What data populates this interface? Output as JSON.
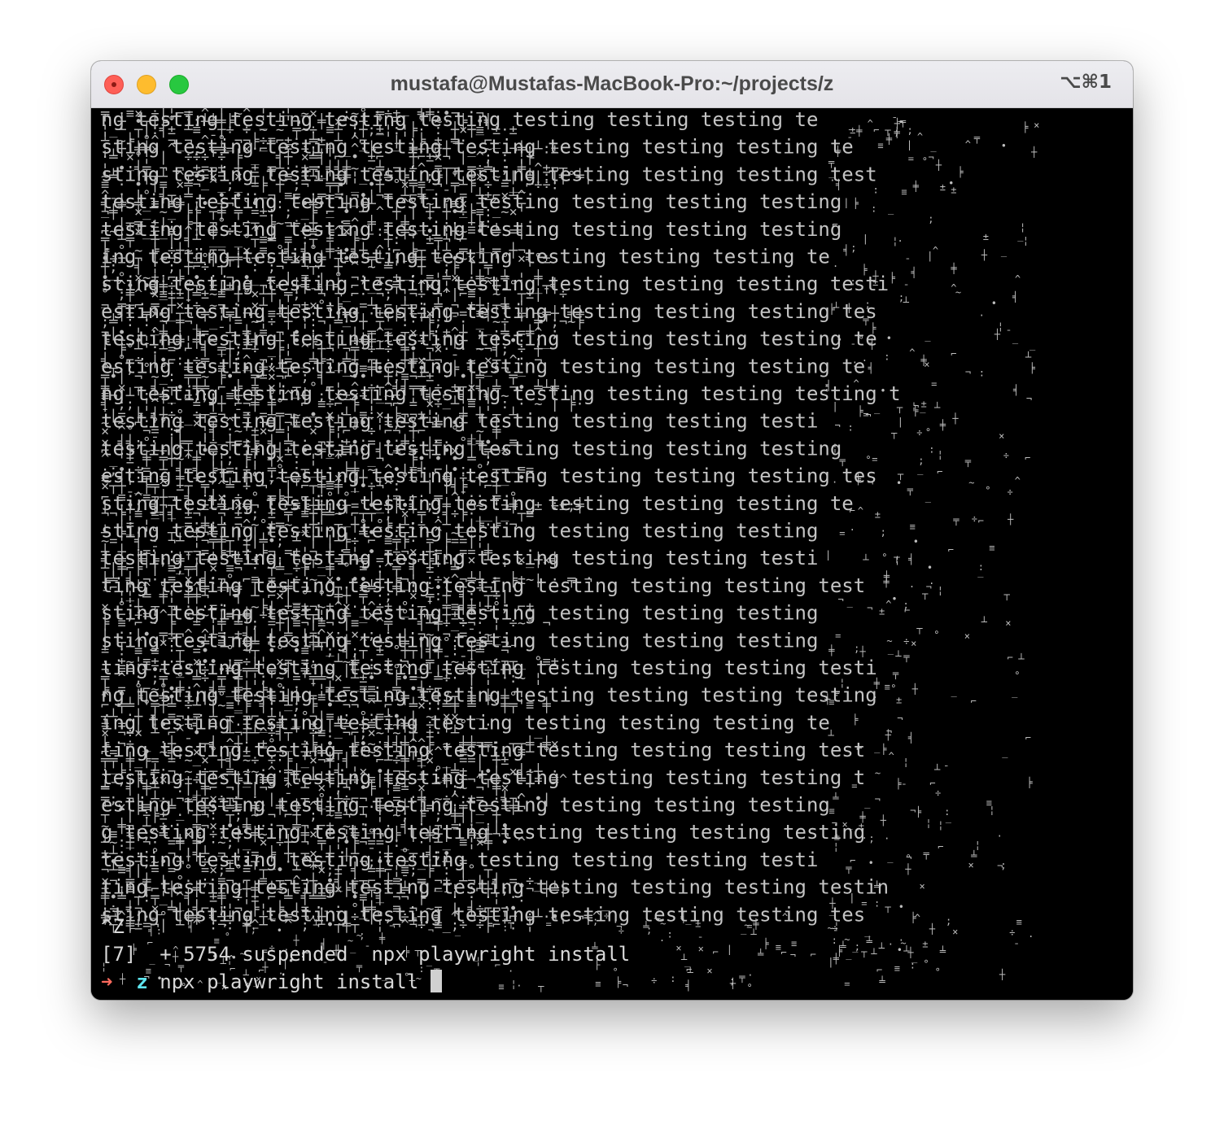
{
  "window": {
    "title": "mustafa@Mustafas-MacBook-Pro:~/projects/z",
    "shortcut": "⌥⌘1"
  },
  "terminal": {
    "noise_word": "testing",
    "ctrl_c_line": "^Z",
    "job_line": "[7]  + 5754 suspended  npx playwright install",
    "prompt": {
      "arrow": "➜",
      "directory": "z",
      "command": "npx playwright install"
    },
    "colors": {
      "background": "#000000",
      "text": "#d8d8d8",
      "prompt_arrow": "#ff6b5e",
      "prompt_directory": "#5ee6f0"
    }
  }
}
